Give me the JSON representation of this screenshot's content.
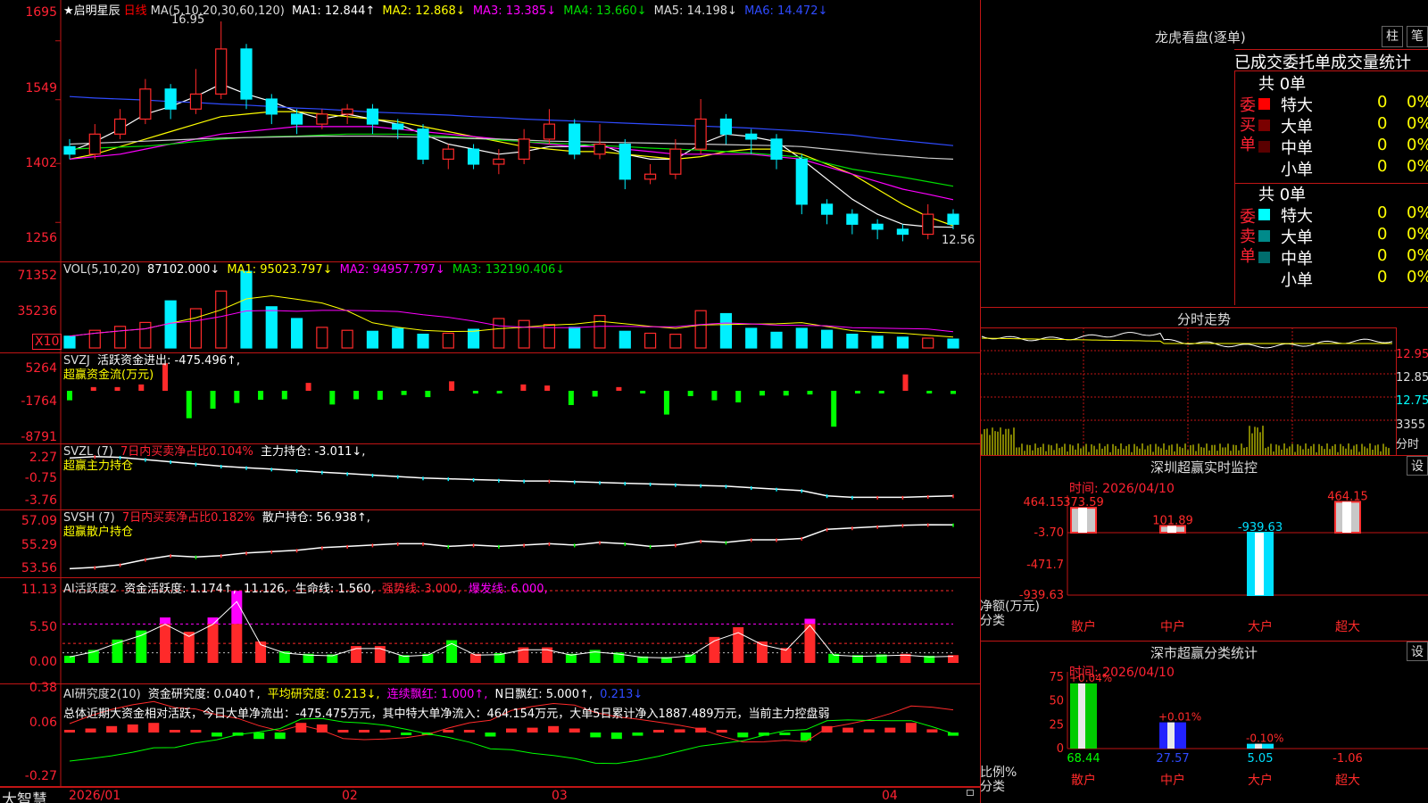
{
  "colors": {
    "up": "#ff2a2a",
    "down": "#00f0ff",
    "grid": "#c01515",
    "text": "#dddddd",
    "white": "#ffffff",
    "yellow": "#ffff00",
    "magenta": "#ff00ff",
    "green": "#00dd00",
    "blue": "#2f4bff"
  },
  "kline": {
    "stock_name": "★启明星辰",
    "period": "日线",
    "ma_title": "MA(5,10,20,30,60,120)",
    "ma1": "MA1: 12.844↑",
    "ma2": "MA2: 12.868↓",
    "ma3": "MA3: 13.385↓",
    "ma4": "MA4: 13.660↓",
    "ma5": "MA5: 14.198↓",
    "ma6": "MA6: 14.472↓",
    "ticks": [
      "1695",
      "1549",
      "1402",
      "1256"
    ],
    "high_label": "16.95",
    "low_label": "12.56",
    "candles": [
      [
        14.45,
        14.3,
        14.6,
        14.2
      ],
      [
        14.3,
        14.7,
        14.9,
        14.2
      ],
      [
        14.7,
        15.0,
        15.2,
        14.6
      ],
      [
        15.0,
        15.6,
        15.8,
        14.9
      ],
      [
        15.6,
        15.2,
        15.7,
        15.0
      ],
      [
        15.2,
        15.5,
        16.0,
        15.1
      ],
      [
        15.5,
        16.4,
        16.95,
        15.4
      ],
      [
        16.4,
        15.4,
        16.5,
        15.2
      ],
      [
        15.4,
        15.1,
        15.5,
        14.9
      ],
      [
        15.1,
        14.9,
        15.2,
        14.7
      ],
      [
        14.9,
        15.1,
        15.2,
        14.8
      ],
      [
        15.1,
        15.2,
        15.3,
        14.9
      ],
      [
        15.2,
        14.9,
        15.3,
        14.7
      ],
      [
        14.9,
        14.8,
        15.0,
        14.6
      ],
      [
        14.8,
        14.2,
        14.9,
        14.1
      ],
      [
        14.2,
        14.4,
        14.5,
        14.0
      ],
      [
        14.4,
        14.1,
        14.5,
        14.0
      ],
      [
        14.1,
        14.2,
        14.4,
        13.9
      ],
      [
        14.2,
        14.6,
        14.8,
        14.1
      ],
      [
        14.6,
        14.9,
        15.2,
        14.5
      ],
      [
        14.9,
        14.3,
        15.0,
        14.2
      ],
      [
        14.3,
        14.5,
        14.9,
        14.2
      ],
      [
        14.5,
        13.8,
        14.6,
        13.6
      ],
      [
        13.8,
        13.9,
        14.1,
        13.7
      ],
      [
        13.9,
        14.4,
        14.6,
        13.8
      ],
      [
        14.4,
        15.0,
        15.4,
        14.3
      ],
      [
        15.0,
        14.7,
        15.1,
        14.5
      ],
      [
        14.7,
        14.6,
        14.8,
        14.3
      ],
      [
        14.6,
        14.2,
        14.7,
        14.0
      ],
      [
        14.2,
        13.3,
        14.3,
        13.1
      ],
      [
        13.3,
        13.1,
        13.4,
        12.9
      ],
      [
        13.1,
        12.9,
        13.2,
        12.7
      ],
      [
        12.9,
        12.8,
        13.0,
        12.6
      ],
      [
        12.8,
        12.7,
        12.9,
        12.56
      ],
      [
        12.7,
        13.1,
        13.3,
        12.6
      ],
      [
        13.1,
        12.9,
        13.2,
        12.8
      ]
    ],
    "ma_lines": {
      "ma1": [
        14.35,
        14.55,
        14.8,
        15.1,
        15.25,
        15.45,
        15.7,
        15.5,
        15.35,
        15.15,
        15.0,
        15.1,
        15.0,
        14.9,
        14.7,
        14.5,
        14.4,
        14.3,
        14.35,
        14.45,
        14.45,
        14.5,
        14.3,
        14.2,
        14.2,
        14.5,
        14.7,
        14.65,
        14.55,
        14.2,
        13.8,
        13.4,
        13.1,
        12.9,
        12.85,
        12.84
      ],
      "ma2": [
        14.2,
        14.3,
        14.45,
        14.6,
        14.75,
        14.9,
        15.05,
        15.1,
        15.15,
        15.15,
        15.1,
        15.05,
        15.0,
        14.95,
        14.85,
        14.75,
        14.65,
        14.55,
        14.45,
        14.4,
        14.35,
        14.35,
        14.3,
        14.25,
        14.2,
        14.25,
        14.35,
        14.4,
        14.4,
        14.3,
        14.1,
        13.9,
        13.6,
        13.3,
        13.05,
        12.87
      ],
      "ma3": [
        14.2,
        14.25,
        14.3,
        14.4,
        14.5,
        14.6,
        14.7,
        14.75,
        14.8,
        14.85,
        14.85,
        14.85,
        14.85,
        14.8,
        14.75,
        14.7,
        14.65,
        14.6,
        14.55,
        14.5,
        14.45,
        14.45,
        14.4,
        14.35,
        14.3,
        14.3,
        14.3,
        14.3,
        14.25,
        14.2,
        14.05,
        13.9,
        13.75,
        13.6,
        13.5,
        13.39
      ],
      "ma4": [
        14.4,
        14.42,
        14.44,
        14.46,
        14.5,
        14.55,
        14.6,
        14.63,
        14.65,
        14.66,
        14.68,
        14.7,
        14.7,
        14.7,
        14.68,
        14.65,
        14.62,
        14.58,
        14.55,
        14.52,
        14.5,
        14.47,
        14.45,
        14.42,
        14.4,
        14.38,
        14.35,
        14.32,
        14.28,
        14.24,
        14.12,
        14.0,
        13.92,
        13.84,
        13.75,
        13.66
      ],
      "ma5": [
        14.5,
        14.52,
        14.54,
        14.56,
        14.58,
        14.6,
        14.62,
        14.63,
        14.64,
        14.65,
        14.66,
        14.66,
        14.66,
        14.65,
        14.64,
        14.63,
        14.61,
        14.6,
        14.58,
        14.56,
        14.55,
        14.54,
        14.53,
        14.52,
        14.51,
        14.5,
        14.49,
        14.48,
        14.47,
        14.45,
        14.4,
        14.35,
        14.3,
        14.26,
        14.22,
        14.2
      ],
      "ma6": [
        15.45,
        15.42,
        15.4,
        15.38,
        15.35,
        15.33,
        15.3,
        15.28,
        15.25,
        15.22,
        15.2,
        15.17,
        15.14,
        15.12,
        15.1,
        15.08,
        15.05,
        15.03,
        15.0,
        14.98,
        14.96,
        14.94,
        14.92,
        14.9,
        14.88,
        14.86,
        14.84,
        14.82,
        14.79,
        14.76,
        14.72,
        14.68,
        14.62,
        14.57,
        14.52,
        14.47
      ]
    },
    "range": [
      12.3,
      17.2
    ]
  },
  "vol": {
    "header": "VOL(5,10,20)",
    "value": "87102.000↓",
    "ma1": "MA1: 95023.797↓",
    "ma2": "MA2: 94957.797↓",
    "ma3": "MA3: 132190.406↓",
    "ticks": [
      "71352",
      "35236"
    ],
    "unit": "X10",
    "bars": [
      12000,
      18000,
      22000,
      26000,
      48000,
      40000,
      58000,
      78000,
      42000,
      30000,
      21000,
      18000,
      17000,
      20000,
      14000,
      15000,
      19000,
      30000,
      28000,
      24000,
      21000,
      33000,
      17000,
      15000,
      14000,
      38000,
      35000,
      20000,
      16000,
      20000,
      18000,
      14000,
      12000,
      11000,
      10000,
      9000
    ]
  },
  "svzj": {
    "name": "SVZJ",
    "line1": "活跃资金进出: -475.496↑,",
    "line2": "超赢资金流(万元)",
    "ticks": [
      "5264",
      "-1764",
      "-8791"
    ],
    "bars": [
      -1800,
      700,
      700,
      1200,
      5200,
      -5200,
      -3400,
      -2300,
      -1700,
      -1600,
      1500,
      -2600,
      -1600,
      -1700,
      -800,
      -1200,
      1800,
      -500,
      -300,
      1200,
      1000,
      -2700,
      -1100,
      700,
      -500,
      -4500,
      -1000,
      -1800,
      -2200,
      -900,
      -900,
      -700,
      -6800,
      -500,
      -300,
      3100,
      -400,
      -600
    ]
  },
  "svzl": {
    "name": "SVZL (7)",
    "desc": "7日内买卖净占比0.104%",
    "holding": "主力持仓: -3.011↓,",
    "sub": "超赢主力持仓",
    "ticks": [
      "2.27",
      "-0.75",
      "-3.76"
    ],
    "line": [
      2.1,
      2.3,
      2.2,
      1.9,
      1.6,
      1.3,
      1.0,
      0.8,
      0.6,
      0.4,
      0.2,
      0.0,
      -0.2,
      -0.4,
      -0.6,
      -0.7,
      -0.8,
      -0.9,
      -1.0,
      -1.0,
      -1.1,
      -1.2,
      -1.3,
      -1.4,
      -1.5,
      -1.6,
      -1.7,
      -1.9,
      -2.1,
      -2.3,
      -3.0,
      -3.2,
      -3.2,
      -3.2,
      -3.1,
      -3.01
    ]
  },
  "svsh": {
    "name": "SVSH (7)",
    "desc": "7日内买卖净占比0.182%",
    "holding": "散户持仓: 56.938↑,",
    "sub": "超赢散户持仓",
    "ticks": [
      "57.09",
      "55.29",
      "53.56"
    ],
    "line": [
      53.6,
      53.7,
      53.9,
      54.3,
      54.6,
      54.5,
      54.6,
      54.8,
      54.9,
      55.0,
      55.2,
      55.3,
      55.4,
      55.5,
      55.5,
      55.3,
      55.4,
      55.3,
      55.4,
      55.5,
      55.4,
      55.6,
      55.5,
      55.3,
      55.4,
      55.7,
      55.6,
      55.8,
      55.8,
      55.9,
      56.6,
      56.7,
      56.8,
      56.9,
      56.95,
      56.94
    ]
  },
  "ai1": {
    "name": "AI活跃度2",
    "active": "资金活跃度: 1.174↑,",
    "v2": "11.126,",
    "life": "生命线: 1.560,",
    "strong": "强势线: 3.000,",
    "burst": "爆发线: 6.000,",
    "ticks": [
      "11.13",
      "5.50",
      "0.00"
    ],
    "bars": [
      1.1,
      2.0,
      3.6,
      5.0,
      7.0,
      4.8,
      7.0,
      11.1,
      3.3,
      1.8,
      1.4,
      1.3,
      2.6,
      2.6,
      1.2,
      1.4,
      3.5,
      1.4,
      1.5,
      2.4,
      2.4,
      1.4,
      2.0,
      1.6,
      1.0,
      0.9,
      1.3,
      4.0,
      5.5,
      3.3,
      2.3,
      6.8,
      1.4,
      1.2,
      1.3,
      1.4,
      1.1,
      1.2
    ]
  },
  "ai2": {
    "name": "AI研究度2(10)",
    "research": "资金研究度: 0.040↑,",
    "avg": "平均研究度: 0.213↓,",
    "red": "连续飘红: 1.000↑,",
    "n": "N日飘红: 5.000↑,",
    "last": "0.213↓",
    "summary": "总体近期大资金相对活跃，今日大单净流出：-475.475万元，其中特大单净流入：464.154万元，大单5日累计净入1887.489万元，当前主力控盘弱",
    "ticks": [
      "0.38",
      "0.06",
      "-0.27"
    ],
    "bars": [
      0.0,
      0.05,
      0.08,
      0.1,
      0.12,
      0.0,
      0.0,
      -0.05,
      -0.04,
      -0.08,
      -0.08,
      0.12,
      0.1,
      0.0,
      0.0,
      0.0,
      -0.02,
      -0.03,
      0.0,
      0.0,
      -0.05,
      0.05,
      0.06,
      0.08,
      0.05,
      -0.06,
      -0.08,
      -0.04,
      0.0,
      0.04,
      0.06,
      0.0,
      -0.06,
      -0.04,
      -0.03,
      -0.1,
      0.08,
      0.06,
      0.04,
      0.06,
      0.12,
      0.04,
      -0.04
    ]
  },
  "footer": {
    "logo": "大智慧",
    "dates": [
      "2026/01",
      "02",
      "03",
      "04"
    ]
  },
  "dragon": {
    "title": "龙虎看盘(逐单)",
    "btn_bar": "柱",
    "btn_pen": "笔",
    "tabs": [
      "已成交",
      "委托单",
      "成交量统计"
    ],
    "buy_label": "委买单",
    "sell_label": "委卖单",
    "buy_total": "共 0单",
    "sell_total": "共 0单",
    "buy_rows": [
      {
        "color": "#ff0000",
        "label": "特大",
        "count": "0",
        "pct": "0%"
      },
      {
        "color": "#7a0000",
        "label": "大单",
        "count": "0",
        "pct": "0%"
      },
      {
        "color": "#5a0000",
        "label": "中单",
        "count": "0",
        "pct": "0%"
      },
      {
        "color": "",
        "label": "小单",
        "count": "0",
        "pct": "0%"
      }
    ],
    "sell_rows": [
      {
        "color": "#00ffff",
        "label": "特大",
        "count": "0",
        "pct": "0%"
      },
      {
        "color": "#008a8a",
        "label": "大单",
        "count": "0",
        "pct": "0%"
      },
      {
        "color": "#006d6d",
        "label": "中单",
        "count": "0",
        "pct": "0%"
      },
      {
        "color": "",
        "label": "小单",
        "count": "0",
        "pct": "0%"
      }
    ]
  },
  "intraday": {
    "title": "分时走势",
    "ticks": [
      "12.95",
      "12.85",
      "12.75"
    ],
    "vol_label": "3355",
    "unit": "分时"
  },
  "monitor": {
    "title": "深圳超赢实时监控",
    "settings": "设",
    "time": "时间: 2026/04/10",
    "ticks": [
      "464.15",
      "-3.70",
      "-471.7",
      "-939.63"
    ],
    "ylabel": "净额(万元)",
    "xlabel": "分类",
    "cats": [
      "散户",
      "中户",
      "大户",
      "超大"
    ],
    "values": [
      "373.59",
      "101.89",
      "-939.63",
      "464.15"
    ],
    "vals_num": [
      373.59,
      101.89,
      -939.63,
      464.15
    ]
  },
  "classify": {
    "title": "深市超赢分类统计",
    "settings": "设",
    "time": "时间: 2026/04/10",
    "ticks": [
      "75",
      "50",
      "25",
      "0"
    ],
    "ylabel": "比例%",
    "xlabel": "分类",
    "cats": [
      "散户",
      "中户",
      "大户",
      "超大"
    ],
    "top_labels": [
      "+0.04%",
      "+0.01%",
      "-0.10%",
      ""
    ],
    "values": [
      "68.44",
      "27.57",
      "5.05",
      "-1.06"
    ],
    "vals_num": [
      68.44,
      27.57,
      5.05,
      -1.06
    ]
  }
}
